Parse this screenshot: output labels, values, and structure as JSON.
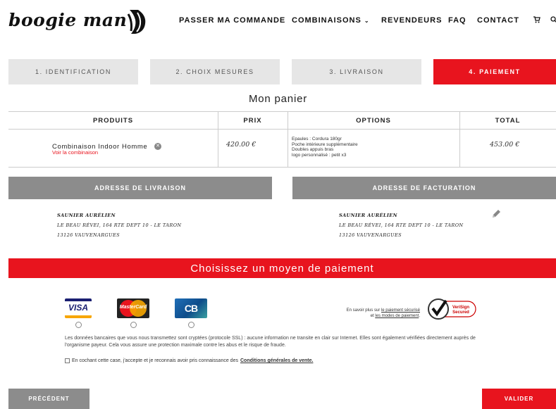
{
  "header": {
    "logo_text": "boogie man",
    "nav": [
      "PASSER MA COMMANDE",
      "COMBINAISONS",
      "REVENDEURS",
      "FAQ",
      "CONTACT"
    ],
    "cart_icon": "cart-icon",
    "search_icon": "search-icon"
  },
  "steps": [
    "1. IDENTIFICATION",
    "2. CHOIX MESURES",
    "3. LIVRAISON",
    "4. PAIEMENT"
  ],
  "cart": {
    "title": "Mon panier",
    "headers": [
      "PRODUITS",
      "PRIX",
      "OPTIONS",
      "TOTAL"
    ],
    "item": {
      "name": "Combinaison Indoor Homme",
      "link": "Voir la combinaison",
      "price": "420.00 €",
      "options": [
        "Epaules : Cordura 180gr",
        "Poche intérieure supplémentaire",
        "Doubles appuis bras",
        "logo personnalisé : petit x3"
      ],
      "total": "453.00 €"
    }
  },
  "addresses": {
    "delivery_title": "ADRESSE DE LIVRAISON",
    "billing_title": "ADRESSE DE FACTURATION",
    "delivery": [
      "SAUNIER AURÉLIEN",
      "LE BEAU RÉVEI, 164 RTE DEPT 10 - LE TARON",
      "13126 VAUVENARGUES"
    ],
    "billing": [
      "SAUNIER AURÉLIEN",
      "LE BEAU RÉVEI, 164 RTE DEPT 10 - LE TARON",
      "13126 VAUVENARGUES"
    ]
  },
  "payment": {
    "title": "Choisissez un moyen de paiement",
    "cards": [
      "VISA",
      "MasterCard",
      "CB"
    ],
    "secure_prefix": "En savoir plus sur",
    "secure_link1": "le paiement sécurisé",
    "secure_mid": "et",
    "secure_link2": "les modes de paiement",
    "verisign": [
      "VeriSign",
      "Secured"
    ],
    "info": "Les données bancaires que vous nous transmettez sont cryptées (protocole SSL) : aucune information ne transite en clair sur Internet. Elles sont également vérifiées directement auprès de l'organisme payeur. Cela vous assure une protection maximale contre les abus et le risque de fraude.",
    "cgv_text": "En cochant cette case, j'accepte et je reconnais avoir pris connaissance des",
    "cgv_link": "Conditions générales de vente."
  },
  "buttons": {
    "prev": "PRÉCÉDENT",
    "validate": "VALIDER"
  },
  "colors": {
    "accent": "#e8141e",
    "grey_button": "#8c8c8c",
    "step_inactive": "#e6e6e6"
  }
}
